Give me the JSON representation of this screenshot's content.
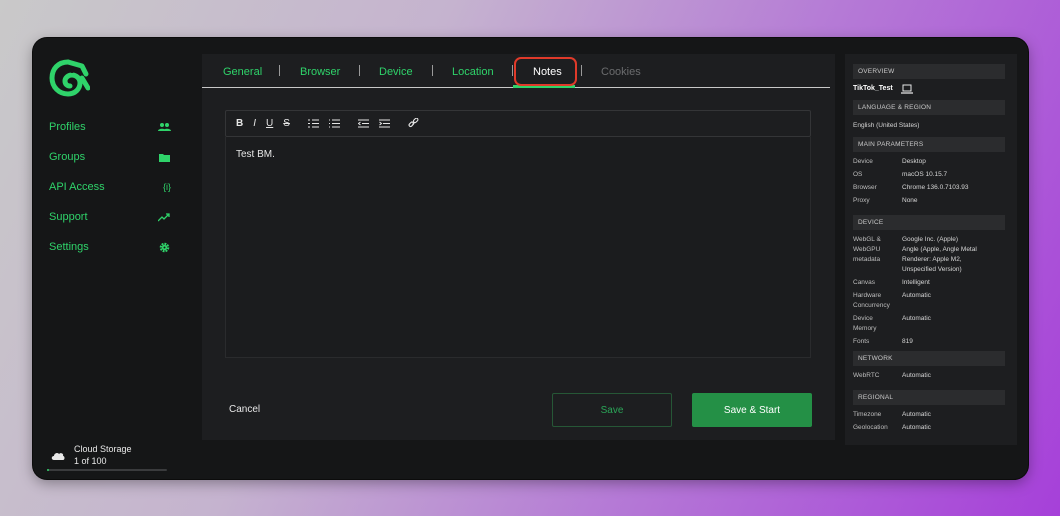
{
  "sidebar": {
    "nav": [
      {
        "label": "Profiles",
        "icon": "users-icon"
      },
      {
        "label": "Groups",
        "icon": "folder-icon"
      },
      {
        "label": "API Access",
        "icon": "braces-icon"
      },
      {
        "label": "Support",
        "icon": "trend-icon"
      },
      {
        "label": "Settings",
        "icon": "gear-icon"
      }
    ],
    "storage": {
      "title": "Cloud Storage",
      "count": "1 of 100",
      "used_fraction": 0.01
    }
  },
  "tabs": [
    {
      "label": "General",
      "state": "normal"
    },
    {
      "label": "Browser",
      "state": "normal"
    },
    {
      "label": "Device",
      "state": "normal"
    },
    {
      "label": "Location",
      "state": "normal"
    },
    {
      "label": "Notes",
      "state": "active"
    },
    {
      "label": "Cookies",
      "state": "disabled"
    }
  ],
  "editor": {
    "toolbar": [
      "B",
      "I",
      "U",
      "S"
    ],
    "content": "Test BM."
  },
  "actions": {
    "cancel": "Cancel",
    "save": "Save",
    "save_start": "Save & Start"
  },
  "overview": {
    "header": "OVERVIEW",
    "profile_name": "TikTok_Test",
    "language_header": "LANGUAGE & REGION",
    "language": "English (United States)",
    "main_header": "MAIN PARAMETERS",
    "main": [
      {
        "key": "Device",
        "value": "Desktop"
      },
      {
        "key": "OS",
        "value": "macOS 10.15.7"
      },
      {
        "key": "Browser",
        "value": "Chrome 136.0.7103.93"
      },
      {
        "key": "Proxy",
        "value": "None"
      }
    ],
    "device_header": "DEVICE",
    "device": {
      "webgl_key": [
        "WebGL &",
        "WebGPU",
        "metadata"
      ],
      "webgl_value": [
        "Google Inc. (Apple)",
        "Angle (Apple, Angle Metal",
        "Renderer: Apple M2,",
        "Unspecified Version)"
      ],
      "canvas_key": "Canvas",
      "canvas_value": "Intelligent",
      "hw_key": [
        "Hardware",
        "Concurrency"
      ],
      "hw_value": "Automatic",
      "mem_key": [
        "Device",
        "Memory"
      ],
      "mem_value": "Automatic",
      "fonts_key": "Fonts",
      "fonts_value": "819"
    },
    "network_header": "NETWORK",
    "webrtc_key": "WebRTC",
    "webrtc_value": "Automatic",
    "regional_header": "REGIONAL",
    "timezone_key": "Timezone",
    "timezone_value": "Automatic",
    "geo_key": "Geolocation",
    "geo_value": "Automatic"
  },
  "colors": {
    "accent": "#2fd36a",
    "highlight": "#e03a2a",
    "primary_button": "#249046"
  }
}
